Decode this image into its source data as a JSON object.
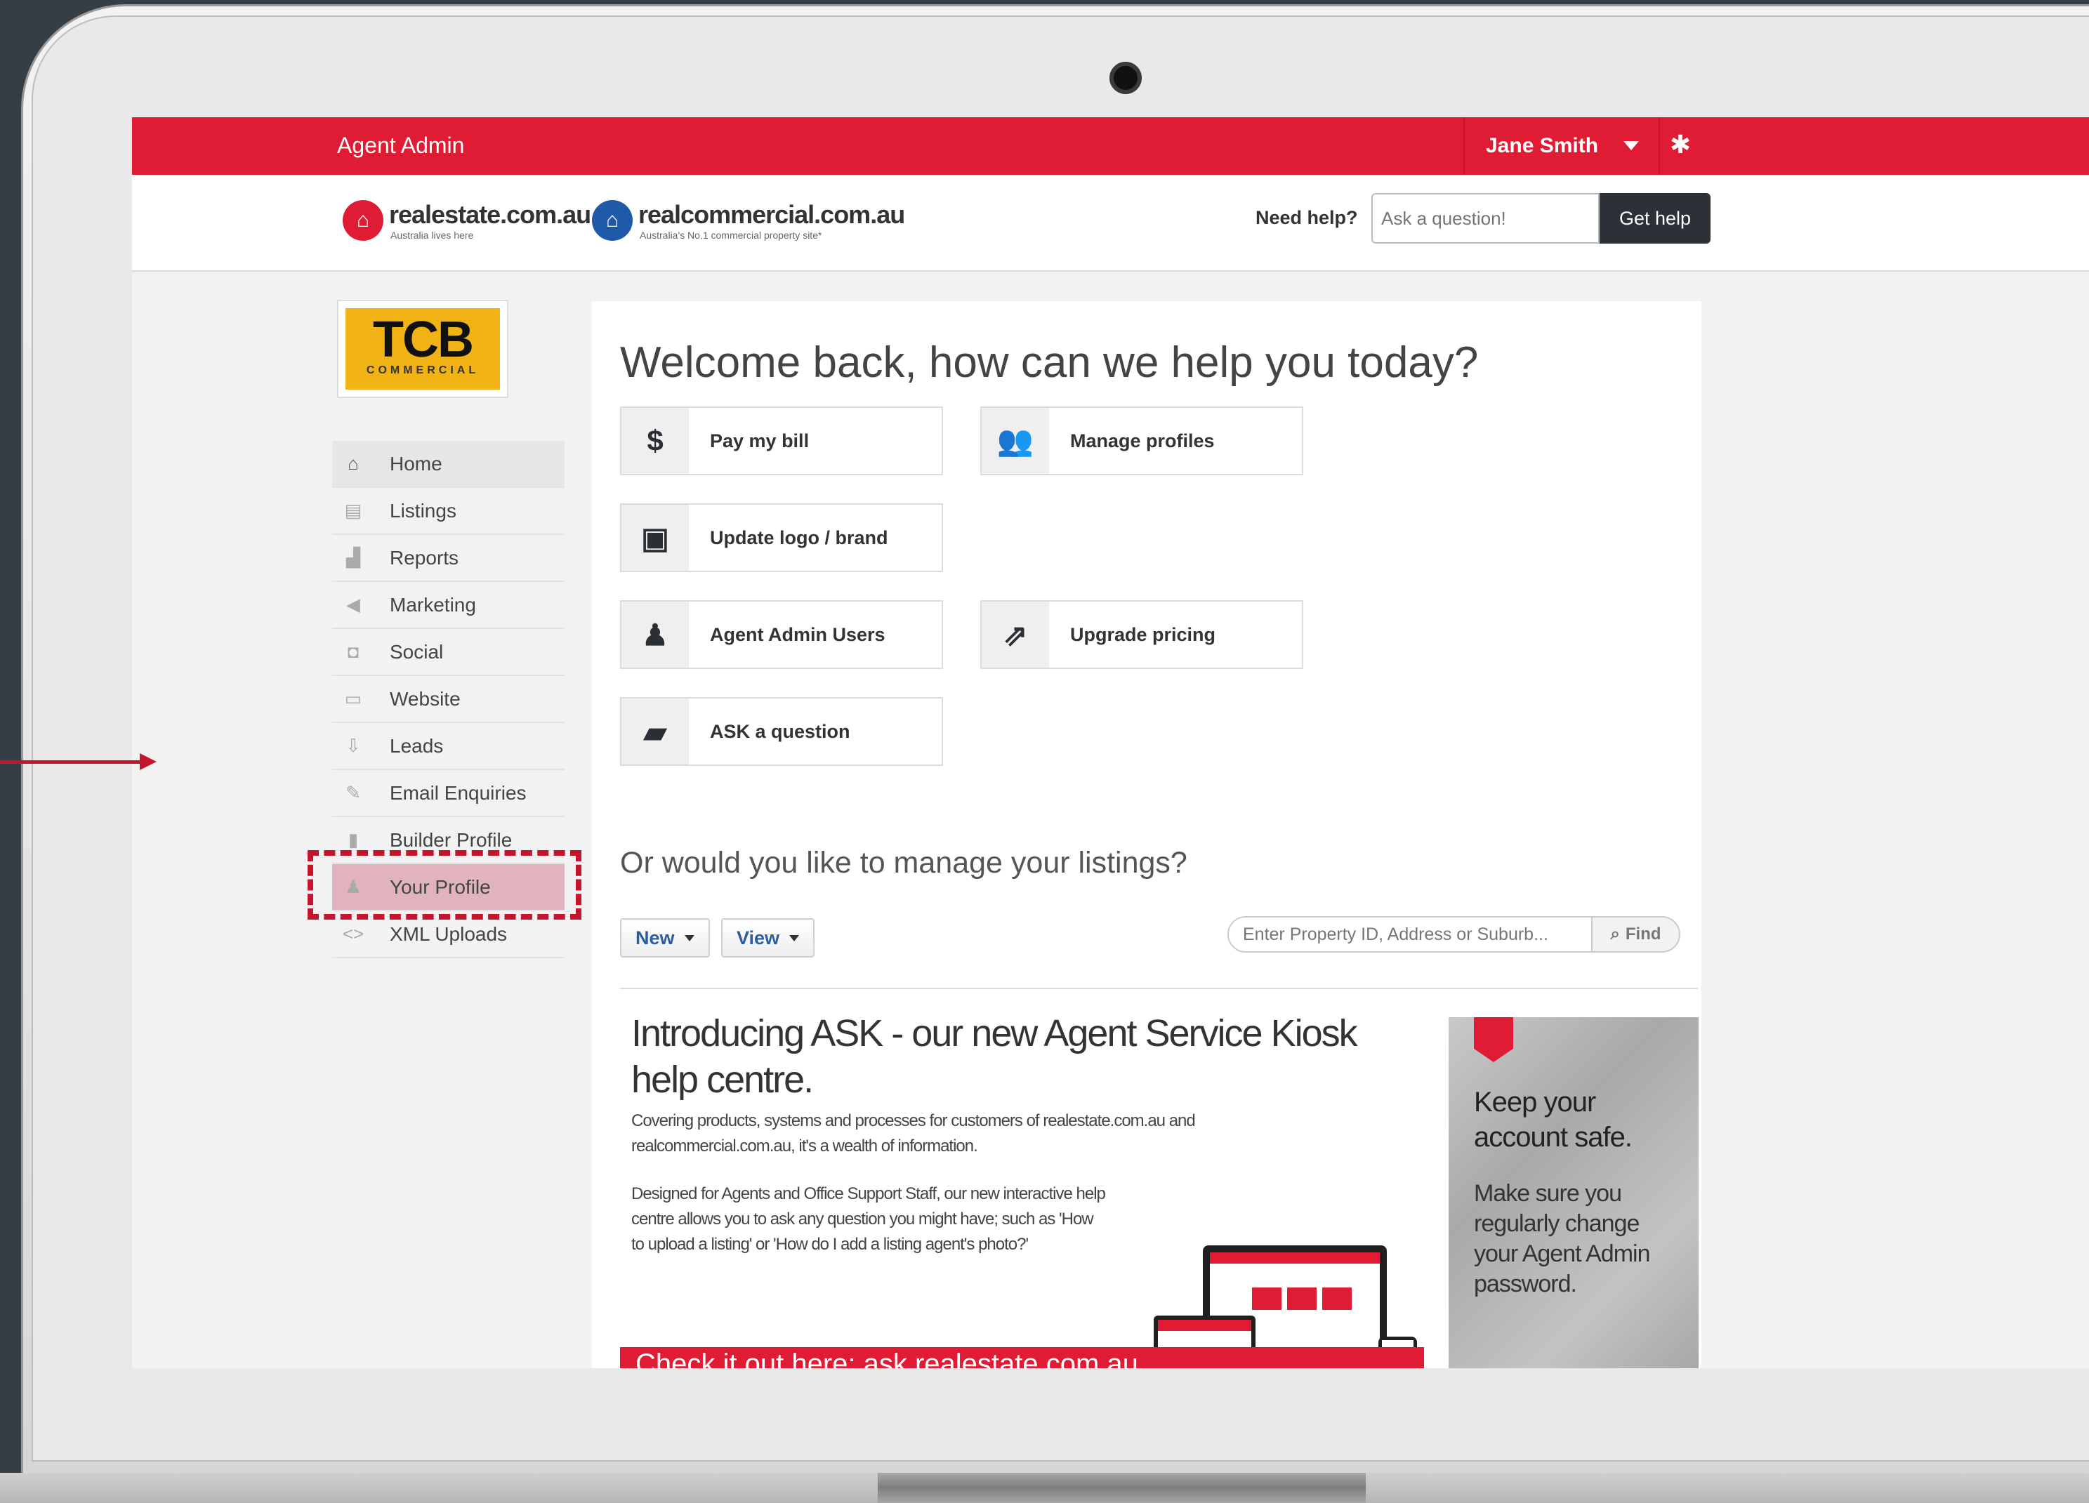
{
  "app_title": "Agent Admin",
  "user": {
    "name": "Jane Smith"
  },
  "header": {
    "logo1": {
      "name": "realestate.com.au",
      "tagline": "Australia lives here",
      "color": "#e01b34"
    },
    "logo2": {
      "name": "realcommercial.com.au",
      "tagline": "Australia's No.1 commercial property site*",
      "color": "#1e5aa8"
    },
    "need_help": "Need help?",
    "ask_placeholder": "Ask a question!",
    "get_help": "Get help"
  },
  "agency_logo": {
    "big": "TCB",
    "small": "COMMERCIAL"
  },
  "nav": [
    {
      "label": "Home",
      "icon": "home-icon",
      "glyph": "⌂"
    },
    {
      "label": "Listings",
      "icon": "listings-icon",
      "glyph": "▤"
    },
    {
      "label": "Reports",
      "icon": "reports-icon",
      "glyph": "▟"
    },
    {
      "label": "Marketing",
      "icon": "megaphone-icon",
      "glyph": "◀"
    },
    {
      "label": "Social",
      "icon": "social-icon",
      "glyph": "◘"
    },
    {
      "label": "Website",
      "icon": "website-icon",
      "glyph": "▭"
    },
    {
      "label": "Leads",
      "icon": "leads-icon",
      "glyph": "⇩"
    },
    {
      "label": "Email Enquiries",
      "icon": "email-icon",
      "glyph": "✎"
    },
    {
      "label": "Builder Profile",
      "icon": "builder-icon",
      "glyph": "▮"
    },
    {
      "label": "Your Profile",
      "icon": "profile-icon",
      "glyph": "♟"
    },
    {
      "label": "XML Uploads",
      "icon": "code-icon",
      "glyph": "<>"
    }
  ],
  "welcome": "Welcome back, how can we help you today?",
  "tiles": {
    "pay_bill": {
      "label": "Pay my bill",
      "glyph": "$"
    },
    "manage_profiles": {
      "label": "Manage profiles",
      "glyph": "👥"
    },
    "update_logo": {
      "label": "Update logo / brand",
      "glyph": "▣"
    },
    "admin_users": {
      "label": "Agent Admin Users",
      "glyph": "♟"
    },
    "upgrade_pricing": {
      "label": "Upgrade pricing",
      "glyph": "⇗"
    },
    "ask_question": {
      "label": "ASK a question",
      "glyph": "▰"
    }
  },
  "listings": {
    "title": "Or would you like to manage your listings?",
    "new_label": "New",
    "view_label": "View",
    "search_placeholder": "Enter Property ID, Address or Suburb...",
    "find_label": "Find"
  },
  "promo": {
    "title": "Introducing ASK - our new Agent Service Kiosk help centre.",
    "p1": "Covering products, systems and processes for customers of realestate.com.au and realcommercial.com.au, it's a wealth of information.",
    "p2": "Designed for Agents and Office Support Staff, our new interactive help centre allows you to ask any question you might have; such as 'How to upload a listing' or 'How do I add a listing agent's photo?'",
    "banner": "Check it out here: ask.realestate.com.au"
  },
  "side_promo": {
    "heading": "Keep your account safe.",
    "text": "Make sure you regularly change your Agent Admin password."
  },
  "colors": {
    "brand_red": "#e01b34",
    "highlight": "#c4152d",
    "dark": "#2c3138"
  }
}
